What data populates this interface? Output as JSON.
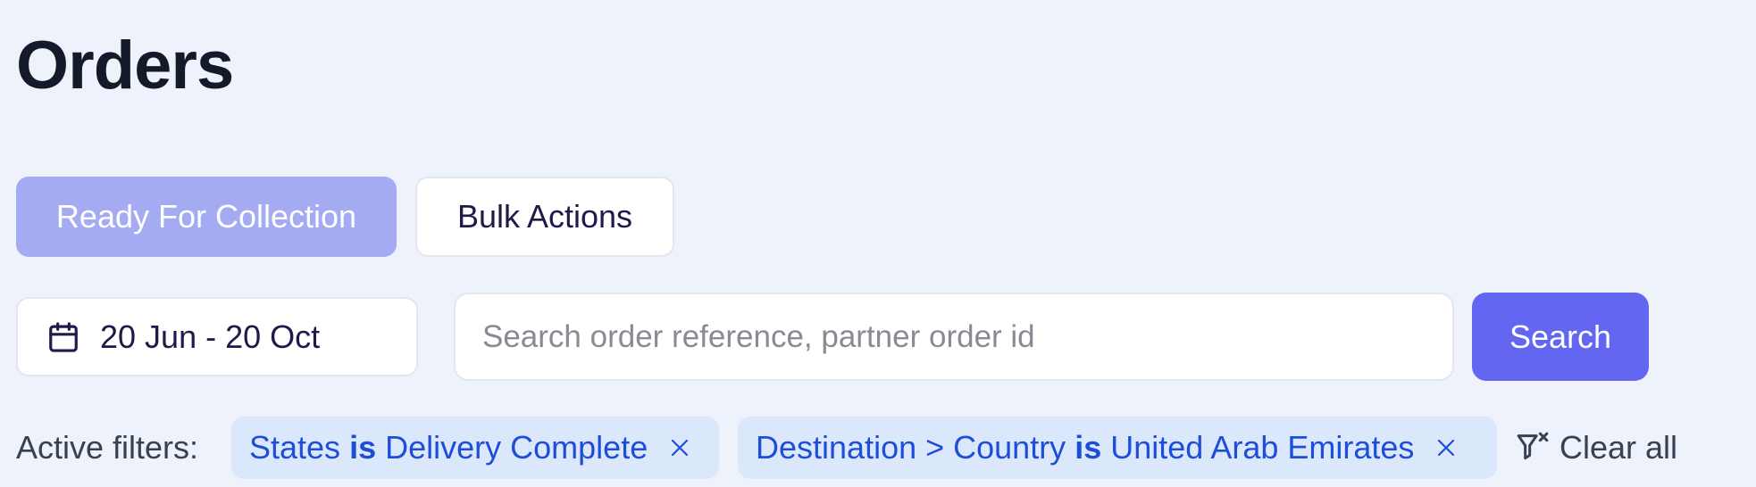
{
  "page": {
    "title": "Orders"
  },
  "actions": {
    "ready_for_collection_label": "Ready For Collection",
    "bulk_actions_label": "Bulk Actions"
  },
  "date_range": {
    "value": "20 Jun - 20 Oct",
    "icon": "calendar-icon"
  },
  "search": {
    "placeholder": "Search order reference, partner order id",
    "value": "",
    "button_label": "Search"
  },
  "filters": {
    "label": "Active filters:",
    "chips": [
      {
        "field": "States",
        "operator": "is",
        "value": "Delivery Complete",
        "remove_icon": "close-icon"
      },
      {
        "field": "Destination > Country",
        "operator": "is",
        "value": "United Arab Emirates",
        "remove_icon": "close-icon"
      }
    ],
    "clear_all_label": "Clear all",
    "clear_all_icon": "filter-clear-icon"
  },
  "colors": {
    "background": "#eef2fa",
    "primary": "#6366f1",
    "primary_disabled": "#a5abf3",
    "chip_background": "#dbe8fc",
    "chip_text": "#1d4ed8"
  }
}
